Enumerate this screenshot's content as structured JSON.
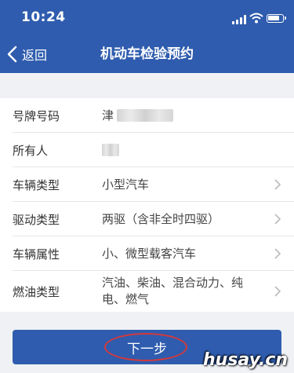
{
  "status_bar": {
    "time": "10:24"
  },
  "nav": {
    "back_label": "返回",
    "title": "机动车检验预约"
  },
  "form": {
    "rows": [
      {
        "label": "号牌号码",
        "value": "津"
      },
      {
        "label": "所有人",
        "value": ""
      },
      {
        "label": "车辆类型",
        "value": "小型汽车"
      },
      {
        "label": "驱动类型",
        "value": "两驱（含非全时四驱）"
      },
      {
        "label": "车辆属性",
        "value": "小、微型载客汽车"
      },
      {
        "label": "燃油类型",
        "value": "汽油、柴油、混合动力、纯电、燃气"
      }
    ]
  },
  "footer": {
    "next_label": "下一步",
    "watermark": "husay.cn"
  },
  "colors": {
    "primary": "#2f5cae",
    "highlight_circle": "#d6383b",
    "background": "#eff1f5"
  },
  "icons": [
    "signal-icon",
    "wifi-icon",
    "battery-icon",
    "back-chevron-icon",
    "chevron-right-icon"
  ]
}
